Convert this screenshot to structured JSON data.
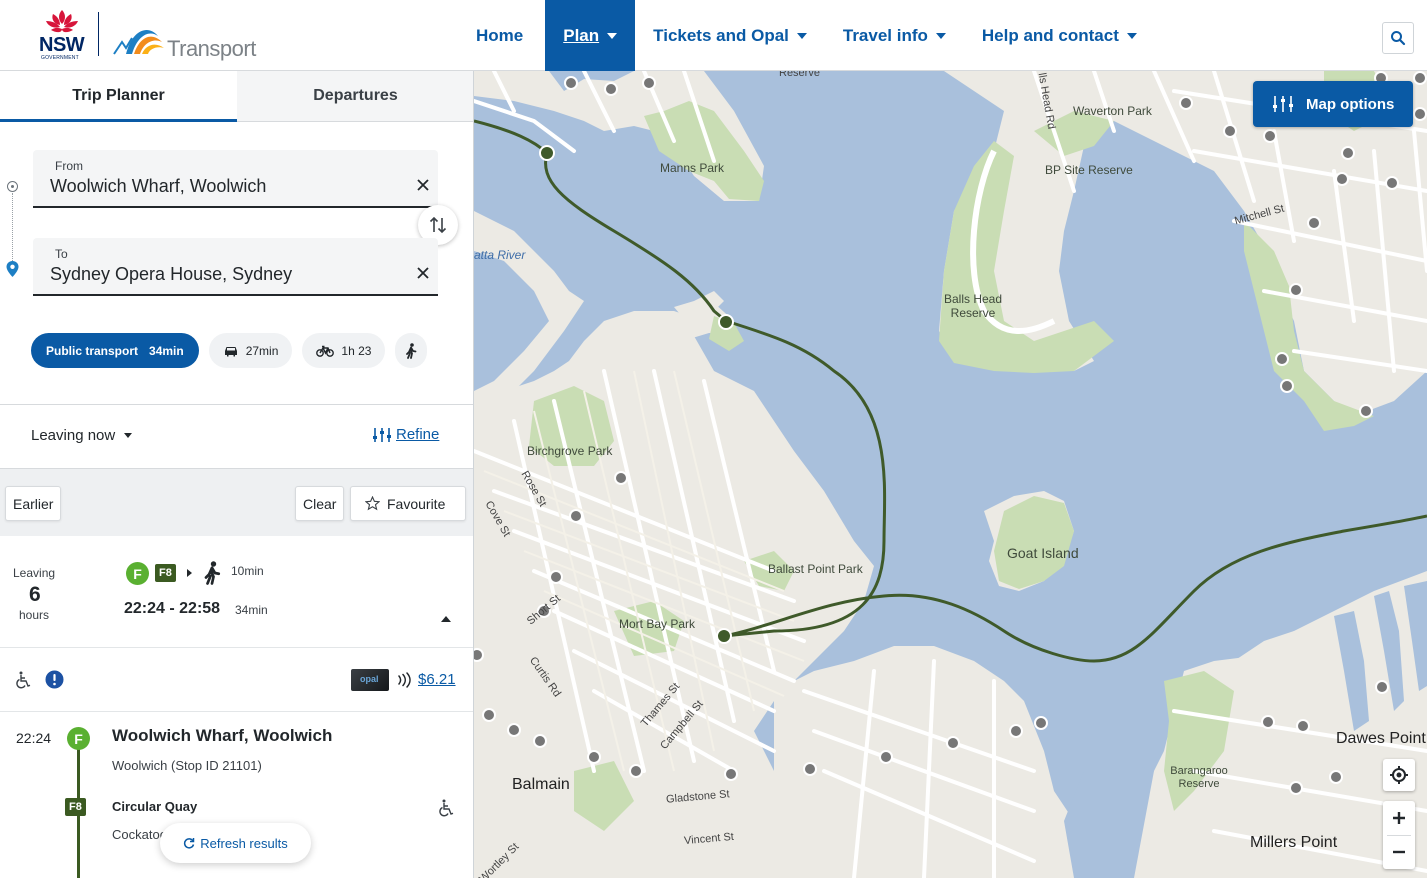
{
  "brand": {
    "nsw_word": "NSW",
    "government_word": "GOVERNMENT",
    "transport_word": "Transport",
    "colors": {
      "primary": "#0a5aa5",
      "nsw_navy": "#002664",
      "ferry_green": "#5ab031",
      "f8_green": "#3b5a21"
    }
  },
  "nav": {
    "items": [
      {
        "label": "Home"
      },
      {
        "label": "Plan"
      },
      {
        "label": "Tickets and Opal"
      },
      {
        "label": "Travel info"
      },
      {
        "label": "Help and contact"
      }
    ],
    "active": "Plan",
    "search_icon": "search-icon"
  },
  "tabs": {
    "trip_planner": "Trip Planner",
    "departures": "Departures"
  },
  "from": {
    "label": "From",
    "value": "Woolwich Wharf, Woolwich"
  },
  "to": {
    "label": "To",
    "value": "Sydney Opera House, Sydney"
  },
  "modes": {
    "public_transport": {
      "label": "Public transport",
      "time": "34min"
    },
    "car": {
      "time": "27min"
    },
    "bike": {
      "time": "1h 23"
    }
  },
  "options": {
    "leaving": "Leaving now",
    "refine": "Refine"
  },
  "result_actions": {
    "earlier": "Earlier",
    "clear": "Clear",
    "favourite": "Favourite"
  },
  "trip": {
    "leaving_label": "Leaving",
    "leaving_in": "6",
    "leaving_unit": "hours",
    "ferry_badge": "F",
    "route_badge": "F8",
    "walk_time": "10min",
    "times": "22:24 - 22:58",
    "duration": "34min",
    "fare": "$6.21",
    "opal_text": "opal"
  },
  "leg": {
    "time": "22:24",
    "stop_name": "Woolwich Wharf, Woolwich",
    "stop_id": "Woolwich (Stop ID 21101)",
    "route": "F8",
    "destination": "Circular Quay",
    "next_stop": "Cockatoo"
  },
  "refresh": "Refresh results",
  "map": {
    "options_label": "Map options",
    "water_labels": {
      "river": "atta River"
    },
    "parks": [
      "Manns Park",
      "Waverton Park",
      "BP Site Reserve",
      "Balls Head Reserve",
      "Birchgrove Park",
      "Ballast Point Park",
      "Goat Island",
      "Mort Bay Park",
      "Barangaroo Reserve"
    ],
    "suburbs": [
      "Balmain",
      "Millers Point",
      "Dawes Point"
    ],
    "streets": [
      "Mitchell St",
      "Rose St",
      "Cove St",
      "Short St",
      "Curtis Rd",
      "Thames St",
      "Campbell St",
      "Gladstone St",
      "Vincent St",
      "Wortley St",
      "Reserve",
      "lls Head Rd"
    ]
  }
}
